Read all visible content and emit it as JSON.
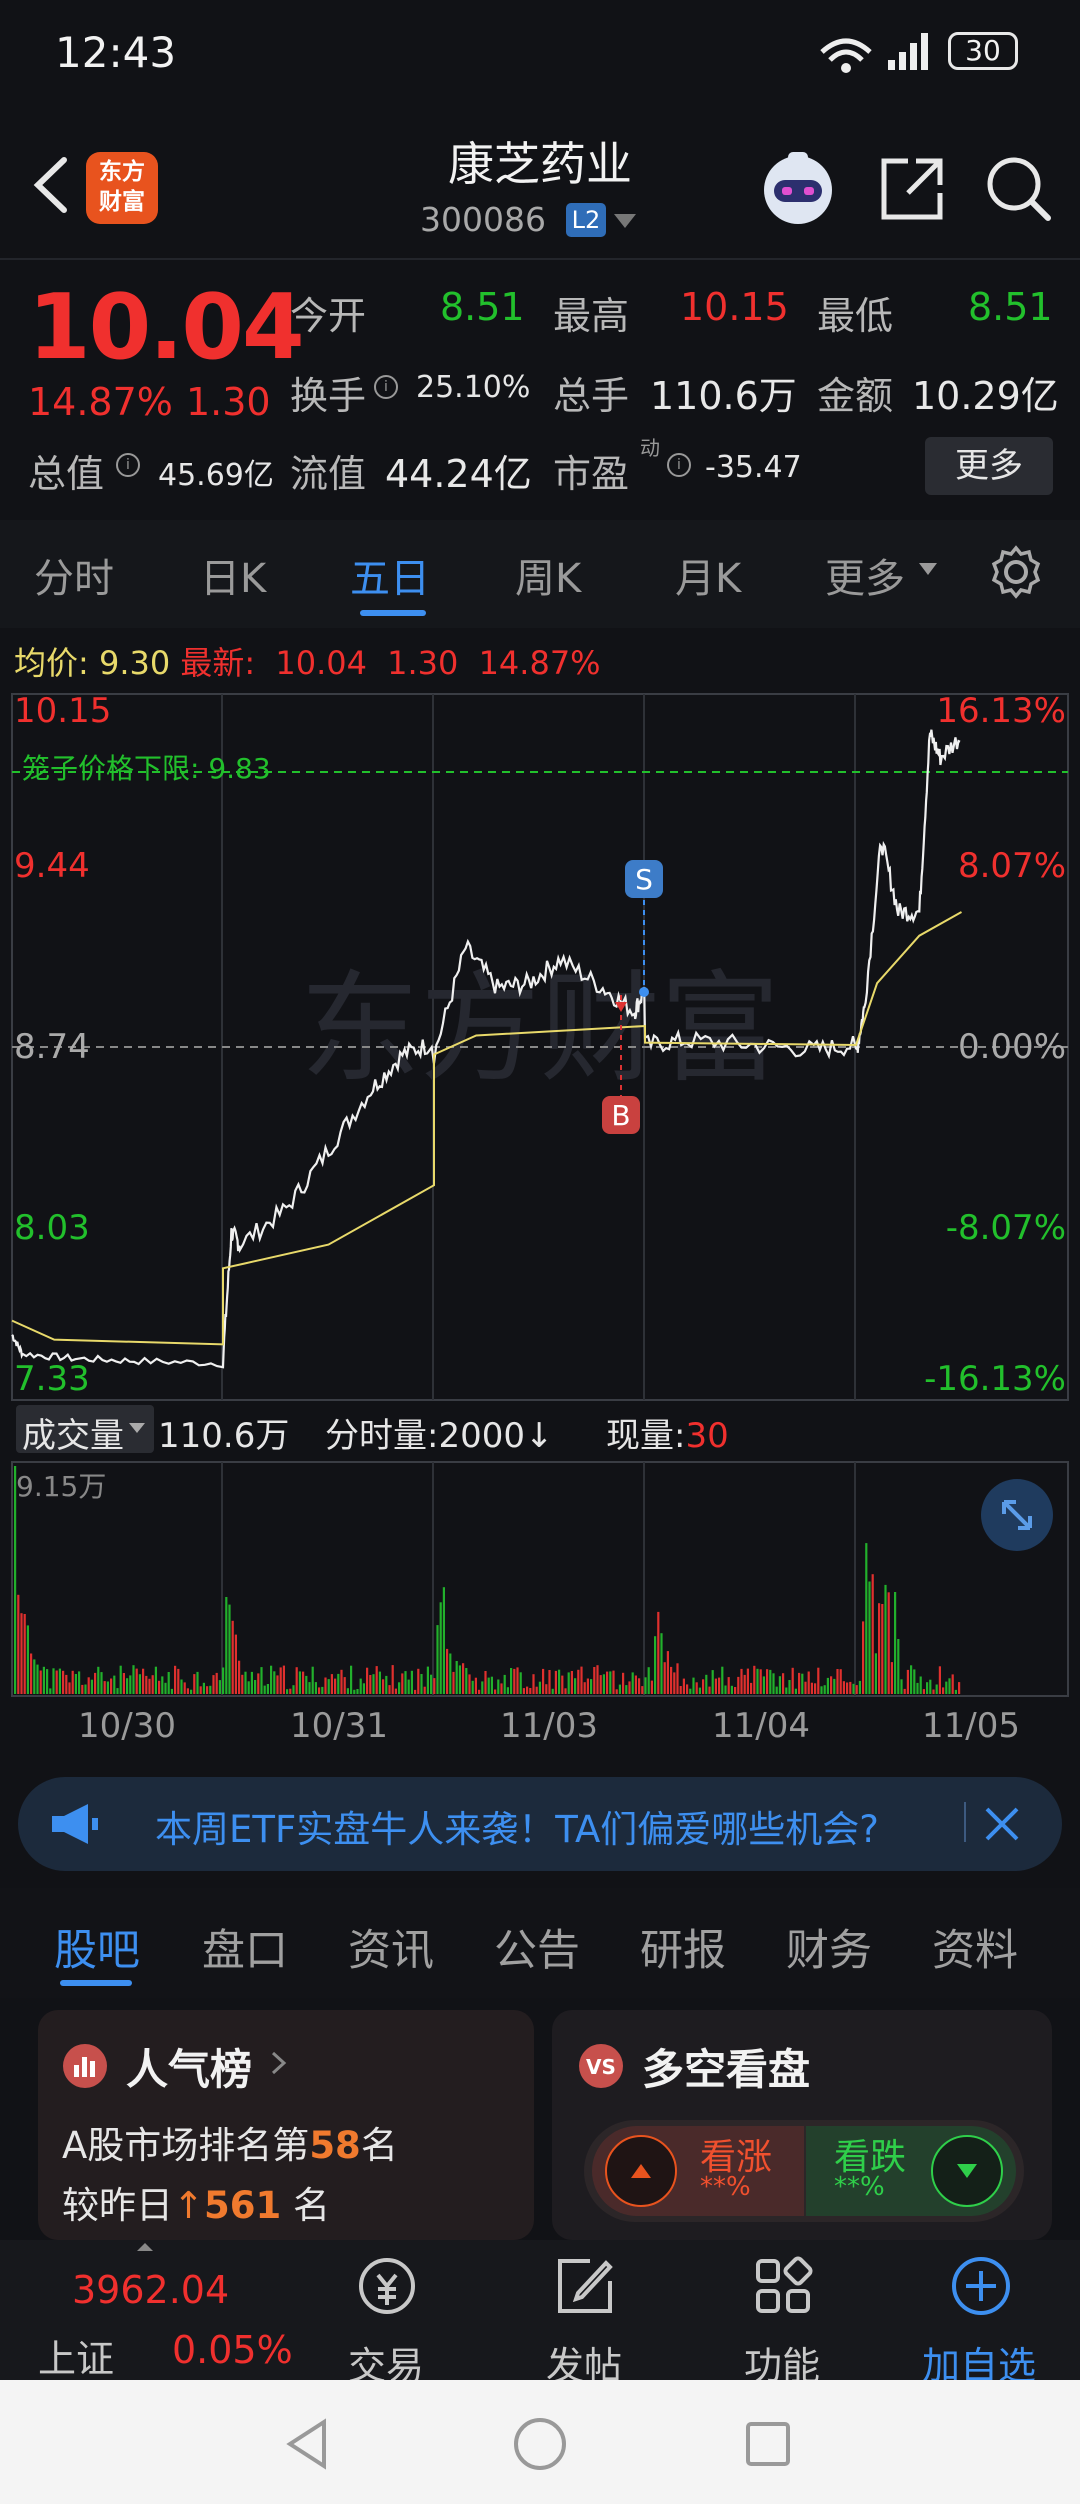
{
  "status_bar": {
    "time": "12:43",
    "battery": "30"
  },
  "header": {
    "logo_text_1": "东方",
    "logo_text_2": "财富",
    "stock_name": "康芝药业",
    "stock_code": "300086",
    "l2_badge": "L2"
  },
  "quote": {
    "price": "10.04",
    "change_pct": "14.87%",
    "change_amt": "1.30",
    "open_label": "今开",
    "open_value": "8.51",
    "high_label": "最高",
    "high_value": "10.15",
    "low_label": "最低",
    "low_value": "8.51",
    "turnover_label": "换手",
    "turnover_value": "25.10%",
    "volume_label": "总手",
    "volume_value": "110.6万",
    "amount_label": "金额",
    "amount_value": "10.29亿",
    "mktcap_label": "总值",
    "mktcap_value": "45.69亿",
    "float_label": "流值",
    "float_value": "44.24亿",
    "pe_label": "市盈",
    "pe_superscript": "动",
    "pe_value": "-35.47",
    "more_button": "更多"
  },
  "chart_tabs": [
    "分时",
    "日K",
    "五日",
    "周K",
    "月K",
    "更多"
  ],
  "chart_tabs_active": "五日",
  "chart_header": {
    "avg_label": "均价:",
    "avg_value": "9.30",
    "latest_label": "最新:",
    "latest_value": "10.04",
    "latest_change": "1.30",
    "latest_pct": "14.87%"
  },
  "chart_labels": {
    "limit_line": "笼子价格下限:  9.83",
    "y_left": [
      "10.15",
      "9.44",
      "8.74",
      "8.03",
      "7.33"
    ],
    "y_right": [
      "16.13%",
      "8.07%",
      "0.00%",
      "-8.07%",
      "-16.13%"
    ],
    "buy_marker": "B",
    "sell_marker": "S",
    "watermark": "东方财富"
  },
  "volume_header": {
    "selector": "成交量",
    "total": "110.6万",
    "tick_label": "分时量:2000",
    "tick_arrow": "↓",
    "current_label": "现量:",
    "current_value": "30",
    "max_label": "9.15万"
  },
  "dates": [
    "10/30",
    "10/31",
    "11/03",
    "11/04",
    "11/05"
  ],
  "chart_data": {
    "type": "line",
    "title": "",
    "x": [
      "10/30",
      "10/31",
      "11/03",
      "11/04",
      "11/05"
    ],
    "ylim": [
      7.33,
      10.15
    ],
    "reference_price": 8.74,
    "series": [
      {
        "name": "最新",
        "values": [
          7.45,
          8.75,
          9.15,
          8.74,
          10.04
        ]
      },
      {
        "name": "均价",
        "values": [
          7.5,
          8.15,
          8.8,
          8.74,
          9.3
        ]
      }
    ],
    "limit_line_value": 9.83,
    "volume_max": "9.15万"
  },
  "banner": {
    "text": "本周ETF实盘牛人来袭！TA们偏爱哪些机会?"
  },
  "section_tabs": [
    "股吧",
    "盘口",
    "资讯",
    "公告",
    "研报",
    "财务",
    "资料"
  ],
  "section_tabs_active": "股吧",
  "card_popularity": {
    "title": "人气榜",
    "rank_prefix": "A股市场排名第",
    "rank": "58",
    "rank_suffix": "名",
    "compare_prefix": "较昨日",
    "compare_value": "561",
    "compare_suffix": "名"
  },
  "card_sentiment": {
    "title": "多空看盘",
    "bull_label": "看涨",
    "bull_pct": "**%",
    "bear_label": "看跌",
    "bear_pct": "**%"
  },
  "bottom_nav": {
    "index_value": "3962.04",
    "index_name": "上证",
    "index_pct": "0.05%",
    "trade": "交易",
    "post": "发帖",
    "function": "功能",
    "add_watch": "加自选"
  },
  "colors": {
    "up": "#f0302e",
    "down": "#22c02c",
    "accent": "#3d8ff0",
    "avg_line": "#e8d96a"
  }
}
